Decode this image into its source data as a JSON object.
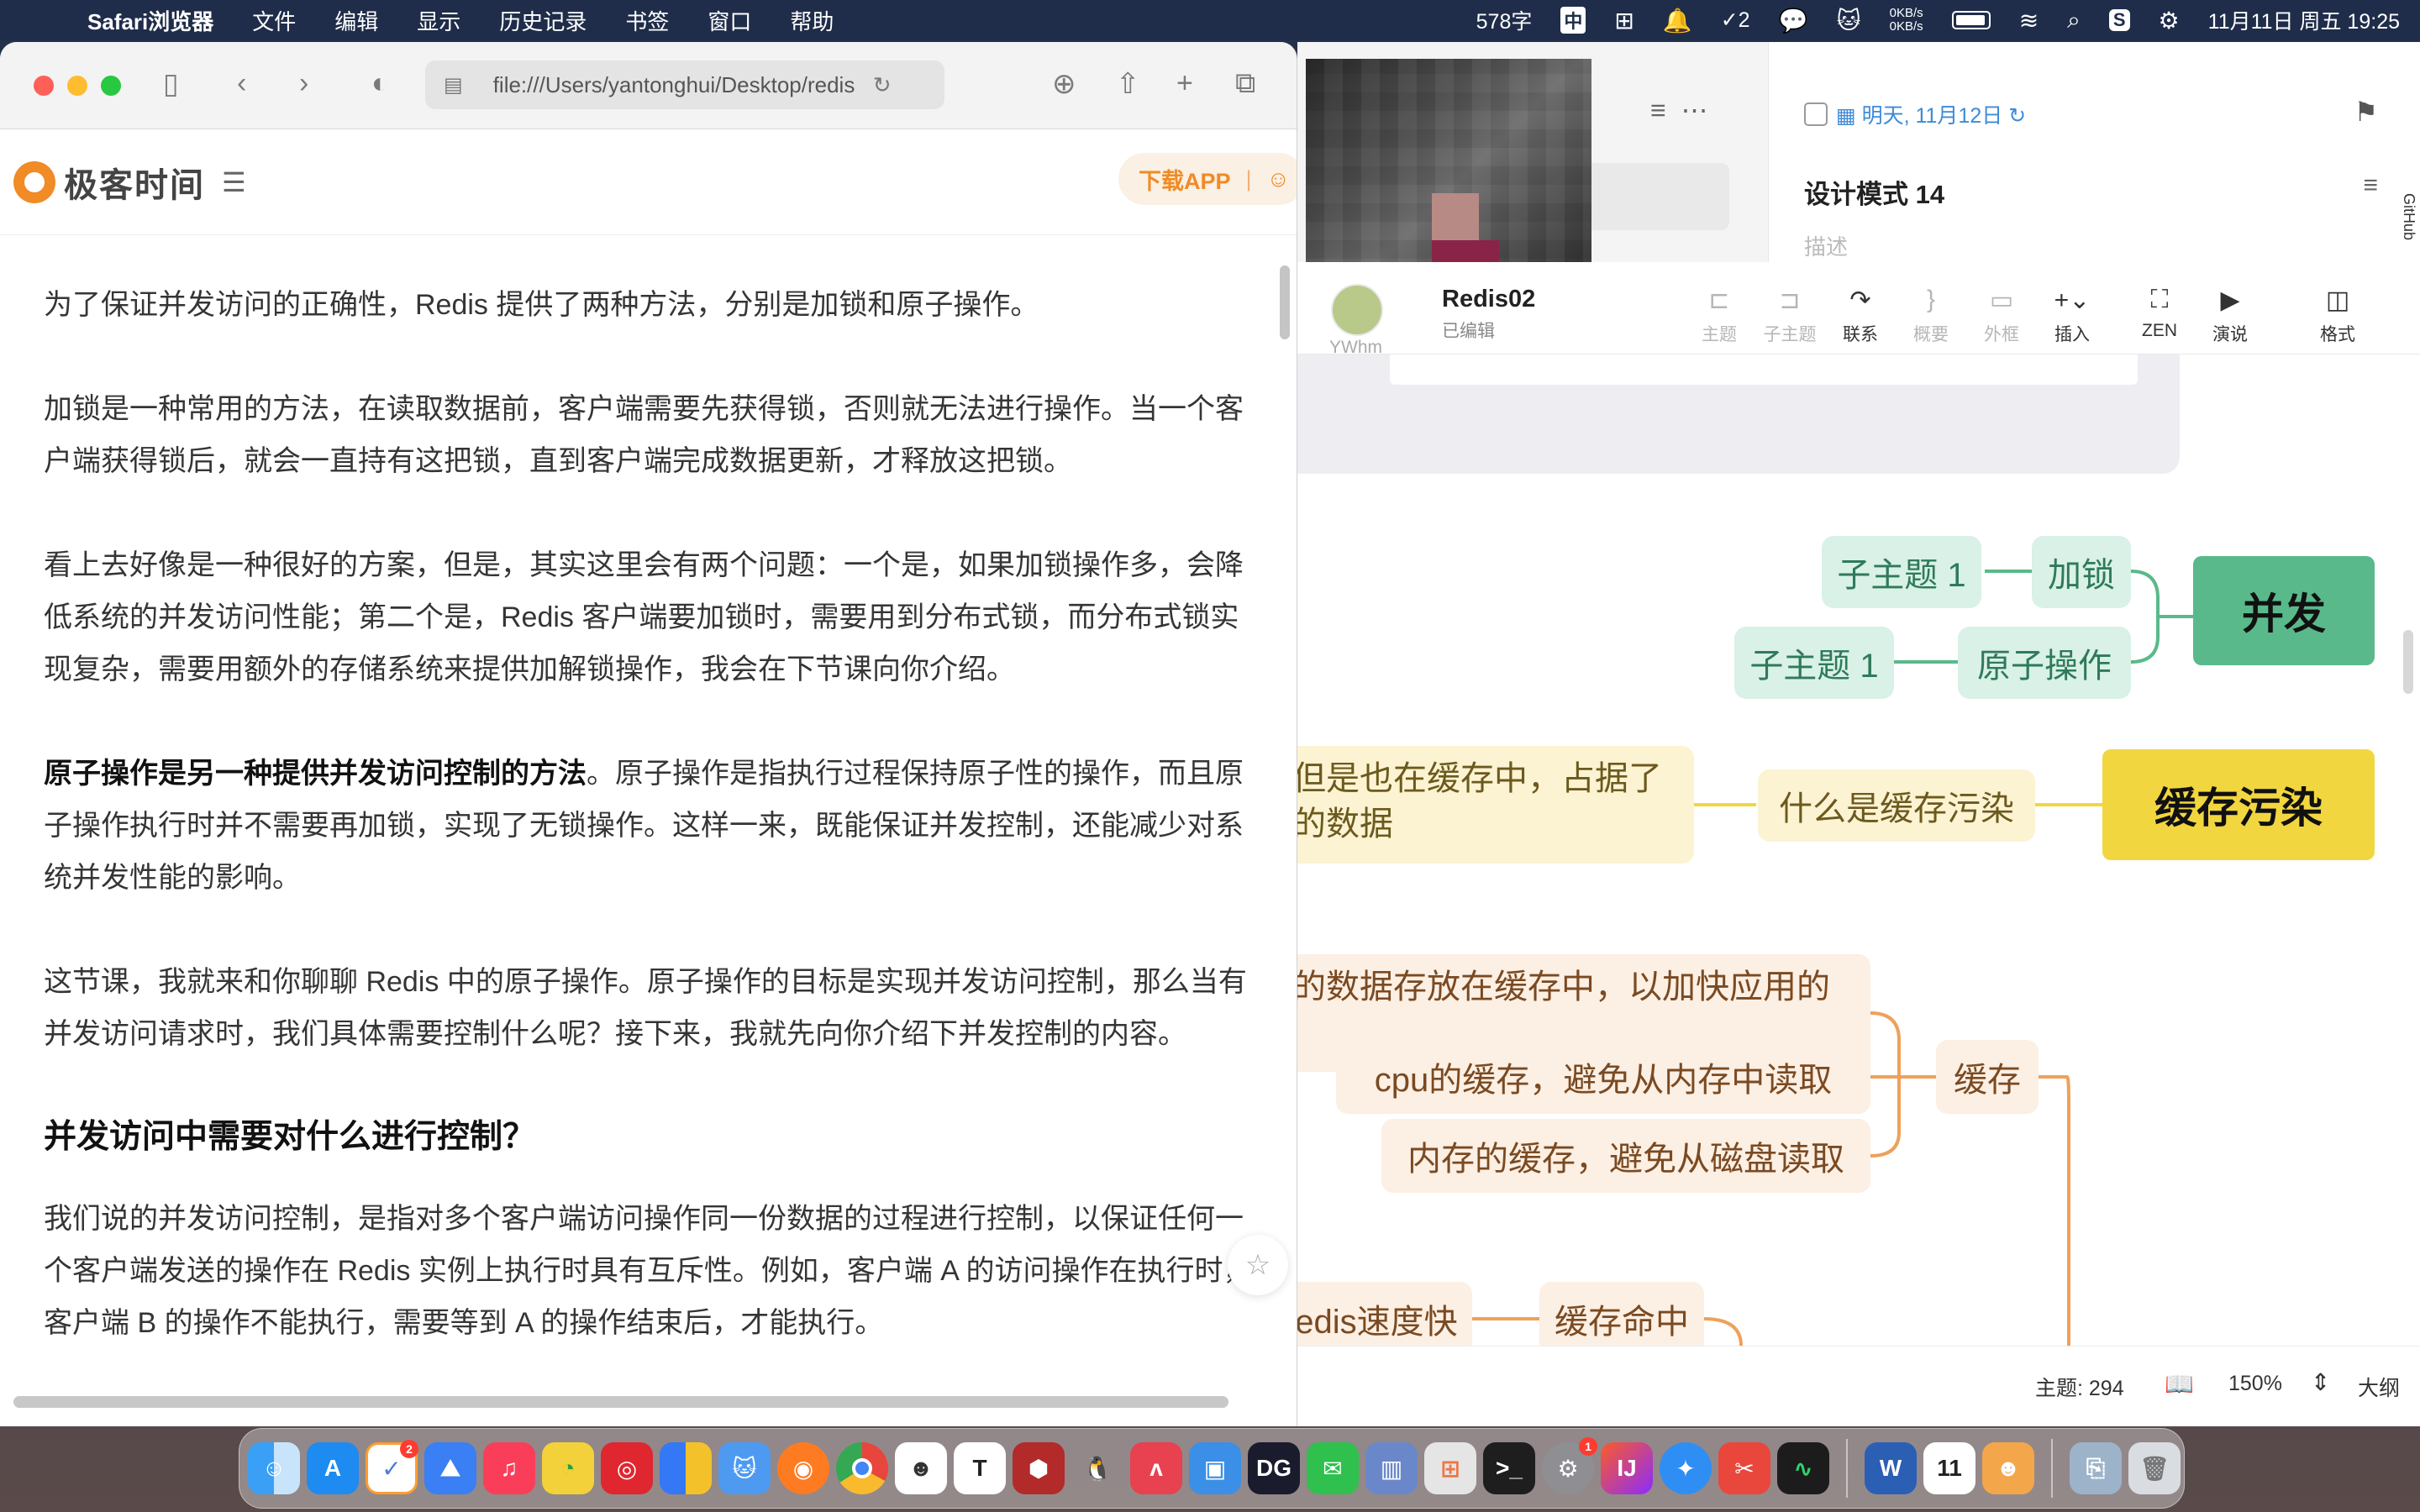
{
  "menubar": {
    "app_name": "Safari浏览器",
    "items": [
      "文件",
      "编辑",
      "显示",
      "历史记录",
      "书签",
      "窗口",
      "帮助"
    ],
    "network_up": "0KB/s",
    "network_down": "0KB/s",
    "input_method_count": "578字",
    "input_method": "中",
    "todo_badge": "2",
    "datetime": "11月11日 周五  19:25"
  },
  "safari": {
    "url": "file:///Users/yantonghui/Desktop/redis",
    "site_logo": "极客时间",
    "download_app": "下载APP",
    "article": {
      "p1": "为了保证并发访问的正确性，Redis 提供了两种方法，分别是加锁和原子操作。",
      "p2": "加锁是一种常用的方法，在读取数据前，客户端需要先获得锁，否则就无法进行操作。当一个客户端获得锁后，就会一直持有这把锁，直到客户端完成数据更新，才释放这把锁。",
      "p3": "看上去好像是一种很好的方案，但是，其实这里会有两个问题：一个是，如果加锁操作多，会降低系统的并发访问性能；第二个是，Redis 客户端要加锁时，需要用到分布式锁，而分布式锁实现复杂，需要用额外的存储系统来提供加解锁操作，我会在下节课向你介绍。",
      "p4_bold": "原子操作是另一种提供并发访问控制的方法",
      "p4_rest": "。原子操作是指执行过程保持原子性的操作，而且原子操作执行时并不需要再加锁，实现了无锁操作。这样一来，既能保证并发控制，还能减少对系统并发性能的影响。",
      "p5": "这节课，我就来和你聊聊 Redis 中的原子操作。原子操作的目标是实现并发访问控制，那么当有并发访问请求时，我们具体需要控制什么呢？接下来，我就先向你介绍下并发控制的内容。",
      "h3": "并发访问中需要对什么进行控制？",
      "p6": "我们说的并发访问控制，是指对多个客户端访问操作同一份数据的过程进行控制，以保证任何一个客户端发送的操作在 Redis 实例上执行时具有互斥性。例如，客户端 A 的访问操作在执行时，客户端 B 的操作不能执行，需要等到 A 的操作结束后，才能执行。"
    }
  },
  "task_panel": {
    "date": "明天, 11月12日",
    "title": "设计模式 14",
    "desc_placeholder": "描述"
  },
  "mindmap": {
    "doc_title": "Redis02",
    "doc_status": "已编辑",
    "avatar_label": "YWhm",
    "tools": [
      {
        "label": "主题",
        "icon": "⊏",
        "enabled": false
      },
      {
        "label": "子主题",
        "icon": "⊐",
        "enabled": false
      },
      {
        "label": "联系",
        "icon": "↷",
        "enabled": true
      },
      {
        "label": "概要",
        "icon": "}",
        "enabled": false
      },
      {
        "label": "外框",
        "icon": "▭",
        "enabled": false
      },
      {
        "label": "插入",
        "icon": "+⌄",
        "enabled": true
      },
      {
        "label": "ZEN",
        "icon": "⛶",
        "enabled": true
      },
      {
        "label": "演说",
        "icon": "▶",
        "enabled": true
      },
      {
        "label": "格式",
        "icon": "◫",
        "enabled": true
      }
    ],
    "nodes": {
      "bingfa": "并发",
      "jiasuo": "加锁",
      "yuanzi": "原子操作",
      "sub1": "子主题 1",
      "sub2": "子主题 1",
      "wuran": "缓存污染",
      "what_wuran": "什么是缓存污染",
      "wuran_desc": "但是也在缓存中，占据了\n的数据",
      "huancun": "缓存",
      "hc_desc": "的数据存放在缓存中，以加快应用的",
      "hc_cpu": "cpu的缓存，避免从内存中读取",
      "hc_mem": "内存的缓存，避免从磁盘读取",
      "mingzhong": "缓存命中",
      "redis_fast": "edis速度快"
    },
    "status": {
      "topic_count": "主题: 294",
      "zoom": "150%",
      "outline": "大纲"
    }
  },
  "colors": {
    "green_main": "#59b98a",
    "yellow_main": "#f2d640",
    "orange_line": "#eea15a",
    "accent_orange": "#f08b25"
  }
}
